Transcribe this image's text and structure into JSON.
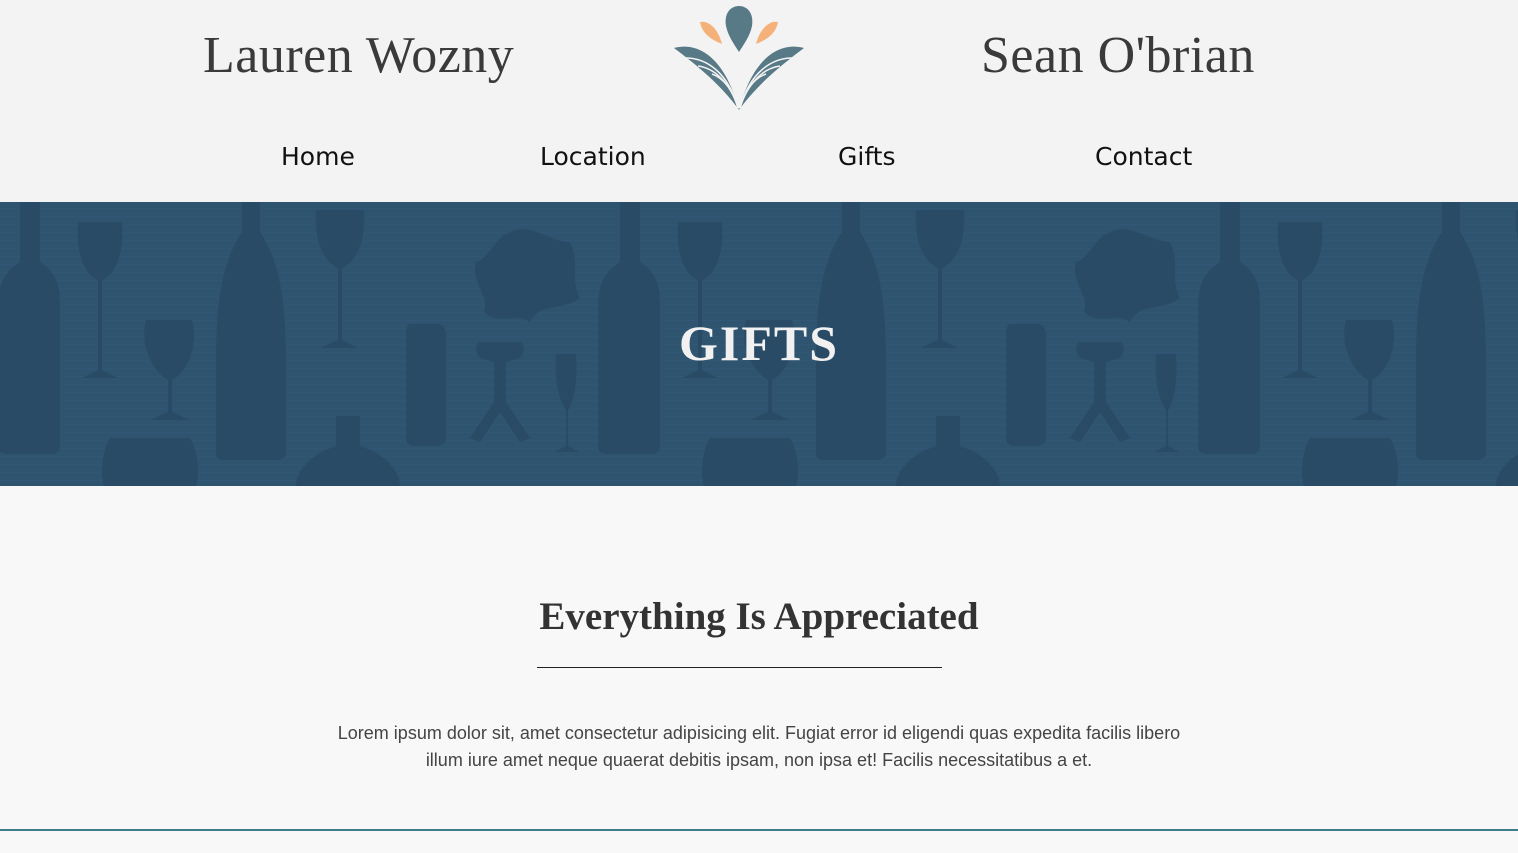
{
  "header": {
    "name_left": "Lauren Wozny",
    "name_right": "Sean O'brian",
    "logo_icon": "floral-fan-icon"
  },
  "nav": {
    "items": [
      {
        "label": "Home"
      },
      {
        "label": "Location"
      },
      {
        "label": "Gifts"
      },
      {
        "label": "Contact"
      }
    ]
  },
  "hero": {
    "title": "GIFTS",
    "background_pattern": "wine-bottles-glasses-corkscrews-pattern",
    "background_color": "#2f5470"
  },
  "main": {
    "heading": "Everything Is Appreciated",
    "body": "Lorem ipsum dolor sit, amet consectetur adipisicing elit. Fugiat error id eligendi quas expedita facilis libero illum iure amet neque quaerat debitis ipsam, non ipsa et! Facilis necessitatibus a et."
  },
  "colors": {
    "accent_blue": "#5a7a8c",
    "accent_orange": "#f4b27a",
    "footer_line": "#3e7f8a"
  }
}
